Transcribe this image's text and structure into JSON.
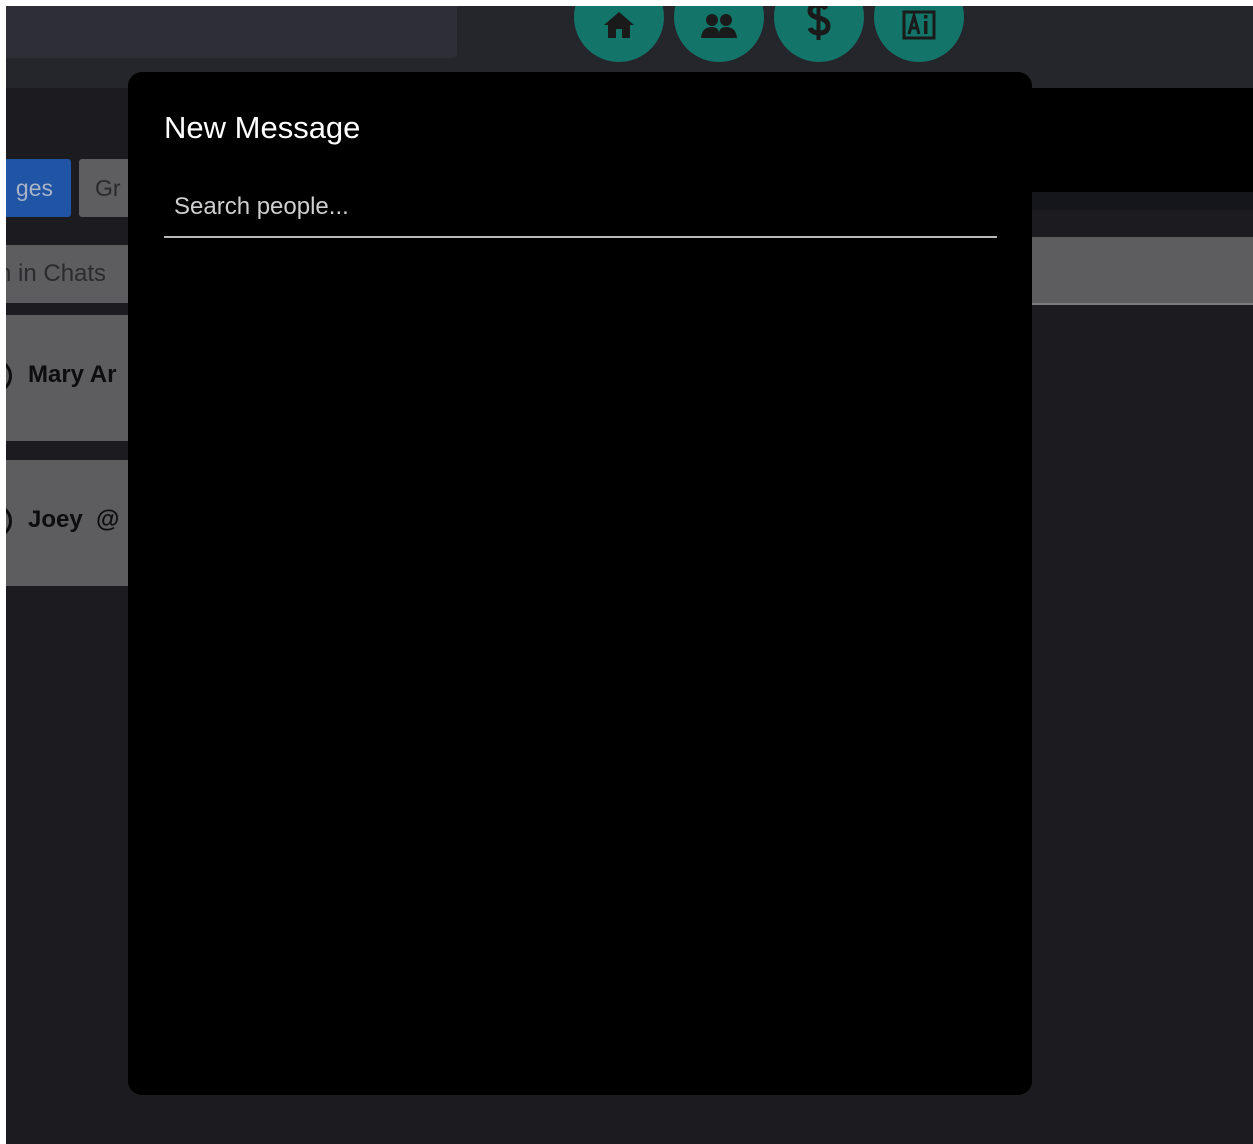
{
  "nav": {
    "buttons": [
      {
        "name": "home",
        "icon": "home-icon"
      },
      {
        "name": "people",
        "icon": "people-icon"
      },
      {
        "name": "money",
        "icon": "dollar-icon"
      },
      {
        "name": "ai",
        "icon": "ai-icon"
      }
    ],
    "accent": "#13756a"
  },
  "sidebar": {
    "tabs": [
      {
        "label": "ges",
        "active": true
      },
      {
        "label": "Gr",
        "active": false
      }
    ],
    "search_placeholder": "h in Chats",
    "chats": [
      {
        "name": "Mary Ar"
      },
      {
        "name": "Joey  @"
      }
    ]
  },
  "modal": {
    "title": "New Message",
    "search_placeholder": "Search people...",
    "search_value": ""
  }
}
